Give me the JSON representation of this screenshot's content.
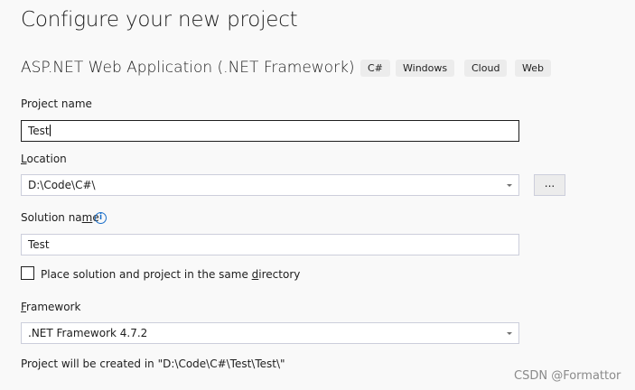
{
  "header": {
    "title": "Configure your new project"
  },
  "template": {
    "name": "ASP.NET Web Application (.NET Framework)",
    "tags": [
      "C#",
      "Windows",
      "Cloud",
      "Web"
    ]
  },
  "project_name": {
    "label": "Project name",
    "value": "Test"
  },
  "location": {
    "label_access_key": "L",
    "label_rest": "ocation",
    "value": "D:\\Code\\C#\\",
    "browse_label": "..."
  },
  "solution_name": {
    "label_before": "Solution na",
    "label_access_key": "m",
    "label_after": "e",
    "value": "Test",
    "info_icon": "info-icon"
  },
  "same_directory": {
    "label_before": "Place solution and project in the same ",
    "label_access_key": "d",
    "label_after": "irectory",
    "checked": false
  },
  "framework": {
    "label_access_key": "F",
    "label_rest": "ramework",
    "value": ".NET Framework 4.7.2"
  },
  "footer": {
    "created_path": "Project will be created in \"D:\\Code\\C#\\Test\\Test\\\""
  },
  "watermark": "CSDN @Formattor",
  "colors": {
    "background": "#f9f9f9",
    "tag_background": "#ececec",
    "info_blue": "#1a6fc9",
    "input_border": "#cccedb"
  }
}
